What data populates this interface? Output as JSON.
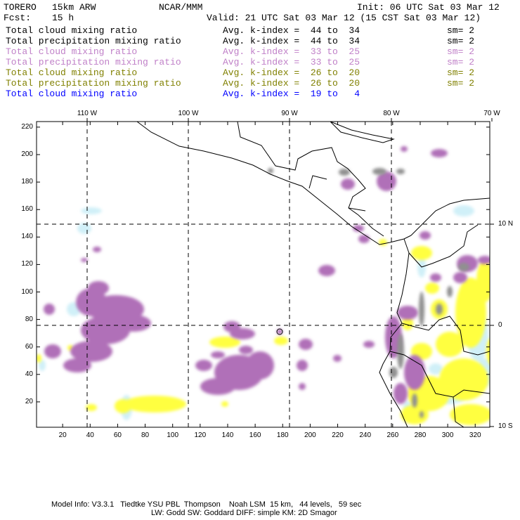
{
  "header": {
    "model": "TORERO",
    "resolution": "15km ARW",
    "org": "NCAR/MMM",
    "init": "Init: 06 UTC Sat 03 Mar 12",
    "fcst_label": "Fcst:",
    "fcst_value": "15 h",
    "valid": "Valid: 21 UTC Sat 03 Mar 12 (15 CST Sat 03 Mar 12)"
  },
  "legend": [
    {
      "field": "Total cloud mixing ratio",
      "range": "Avg. k-index =  44 to  34",
      "sm": "sm= 2",
      "color": "#000000"
    },
    {
      "field": "Total precipitation mixing ratio",
      "range": "Avg. k-index =  44 to  34",
      "sm": "sm= 2",
      "color": "#000000"
    },
    {
      "field": "Total cloud mixing ratio",
      "range": "Avg. k-index =  33 to  25",
      "sm": "sm= 2",
      "color": "#c080c8"
    },
    {
      "field": "Total precipitation mixing ratio",
      "range": "Avg. k-index =  33 to  25",
      "sm": "sm= 2",
      "color": "#c080c8"
    },
    {
      "field": "Total cloud mixing ratio",
      "range": "Avg. k-index =  26 to  20",
      "sm": "sm= 2",
      "color": "#808000"
    },
    {
      "field": "Total precipitation mixing ratio",
      "range": "Avg. k-index =  26 to  20",
      "sm": "sm= 2",
      "color": "#808000"
    },
    {
      "field": "Total cloud mixing ratio",
      "range": "Avg. k-index =  19 to   4",
      "sm": "",
      "color": "#0000ff"
    }
  ],
  "axes": {
    "longitude_labels": [
      "110 W",
      "100 W",
      "90 W",
      "80 W",
      "70 W"
    ],
    "latitude_labels": [
      "10 N",
      "0",
      "10 S"
    ],
    "y_ticks": [
      "220",
      "200",
      "180",
      "160",
      "140",
      "120",
      "100",
      "80",
      "60",
      "40",
      "20"
    ],
    "x_ticks": [
      "20",
      "40",
      "60",
      "80",
      "100",
      "120",
      "140",
      "160",
      "180",
      "200",
      "220",
      "240",
      "260",
      "280",
      "300",
      "320"
    ]
  },
  "colors": {
    "purple": "#b070b8",
    "yellow": "#ffff40",
    "light_blue": "#d0f0f8",
    "gray": "#909090"
  },
  "footer": {
    "line1": "Model Info: V3.3.1   Tiedtke YSU PBL  Thompson    Noah LSM  15 km,   44 levels,   59 sec",
    "line2": "LW: Godd SW: Goddard DIFF: simple KM: 2D Smagor"
  }
}
